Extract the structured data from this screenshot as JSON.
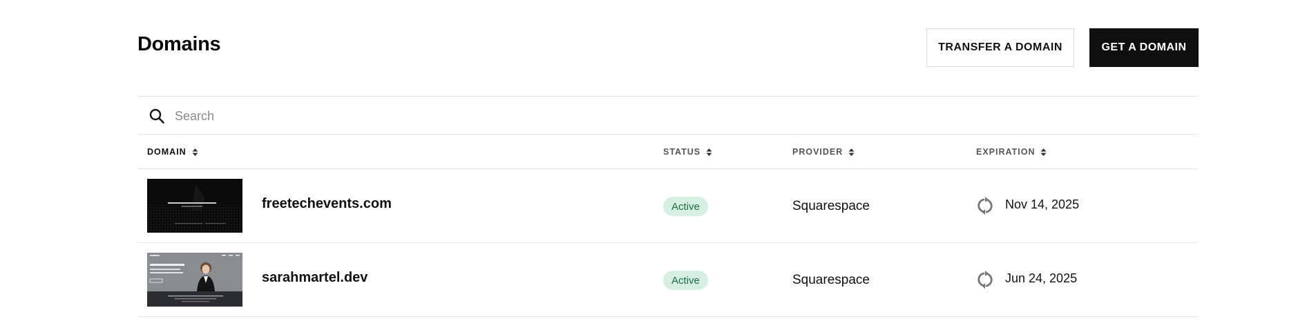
{
  "header": {
    "title": "Domains",
    "transfer_label": "TRANSFER A DOMAIN",
    "get_label": "GET A DOMAIN"
  },
  "search": {
    "placeholder": "Search",
    "value": ""
  },
  "table": {
    "columns": [
      {
        "label": "DOMAIN"
      },
      {
        "label": "STATUS"
      },
      {
        "label": "PROVIDER"
      },
      {
        "label": "EXPIRATION"
      }
    ],
    "rows": [
      {
        "domain": "freetechevents.com",
        "status": "Active",
        "provider": "Squarespace",
        "expiration": "Nov 14, 2025",
        "thumbnail": "dark-site-thumbnail"
      },
      {
        "domain": "sarahmartel.dev",
        "status": "Active",
        "provider": "Squarespace",
        "expiration": "Jun 24, 2025",
        "thumbnail": "portrait-site-thumbnail"
      }
    ]
  },
  "colors": {
    "primary_button_bg": "#0f0f0f",
    "status_active_bg": "#d5f0e1",
    "status_active_text": "#1c6b43",
    "divider": "#e6e6e6"
  },
  "icons": [
    "search-icon",
    "sort-icon",
    "auto-renew-icon"
  ]
}
